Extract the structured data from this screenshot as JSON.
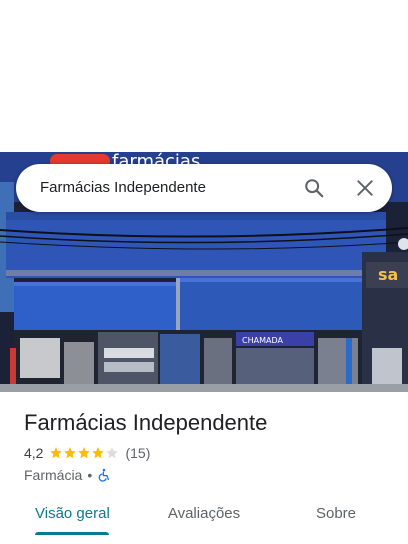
{
  "search": {
    "query": "Farmácias Independente",
    "search_icon": "search-icon",
    "close_icon": "close-icon"
  },
  "photo": {
    "sign_text": "farmácias",
    "side_sign_text": "sa",
    "banner_text": "CHAMADA"
  },
  "place": {
    "title": "Farmácias Independente",
    "rating": "4,2",
    "rating_value": 4.2,
    "stars_total": 5,
    "review_count": "(15)",
    "category": "Farmácia",
    "separator": "•",
    "accessibility_icon": "wheelchair-icon"
  },
  "tabs": [
    {
      "label": "Visão geral",
      "active": true
    },
    {
      "label": "Avaliações",
      "active": false
    },
    {
      "label": "Sobre",
      "active": false
    }
  ],
  "colors": {
    "star": "#fbbc04",
    "star_empty": "#dadce0",
    "accent": "#0b7a8f",
    "accessibility": "#1a73e8"
  }
}
